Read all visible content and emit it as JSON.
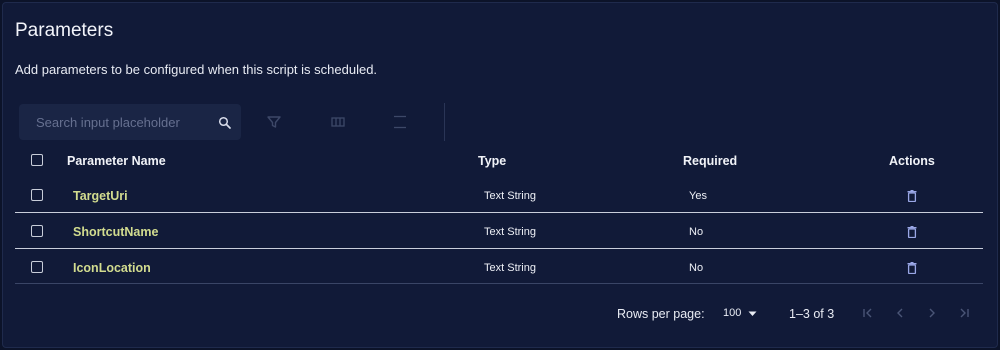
{
  "header": {
    "title": "Parameters",
    "subtitle": "Add parameters to be configured when this script is scheduled."
  },
  "toolbar": {
    "search_placeholder": "Search input placeholder",
    "search_value": "",
    "icons": [
      "search-icon",
      "filter-icon",
      "columns-icon",
      "density-icon"
    ]
  },
  "table": {
    "columns": {
      "name": "Parameter Name",
      "type": "Type",
      "required": "Required",
      "actions": "Actions"
    },
    "rows": [
      {
        "name": "TargetUri",
        "type": "Text String",
        "required": "Yes"
      },
      {
        "name": "ShortcutName",
        "type": "Text String",
        "required": "No"
      },
      {
        "name": "IconLocation",
        "type": "Text String",
        "required": "No"
      }
    ]
  },
  "pagination": {
    "rows_per_page_label": "Rows per page:",
    "rows_per_page_value": "100",
    "range_text": "1–3 of 3"
  },
  "colors": {
    "background": "#111a38",
    "name_text": "#d2dc8f",
    "action_icon": "#9aa7e6"
  }
}
